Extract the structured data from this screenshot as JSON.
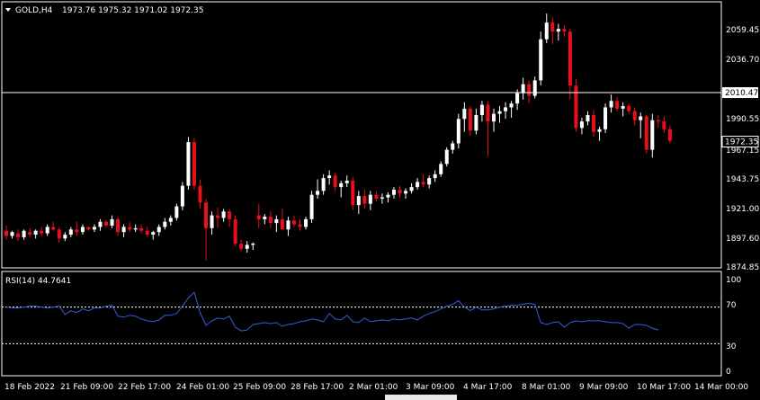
{
  "header": {
    "symbol": "GOLD,H4",
    "ohlc": "1973.76 1975.32 1971.02 1972.35"
  },
  "rsi_header": "RSI(14) 44.7641",
  "colors": {
    "background": "#000000",
    "bull": "#ffffff",
    "bear": "#e8101a",
    "rsi": "#2f5fd8",
    "grid": "#ffffff",
    "hline": "#ffffff"
  },
  "chart_data": [
    {
      "type": "candlestick",
      "symbol": "GOLD",
      "timeframe": "H4",
      "ylim": [
        1870,
        2080
      ],
      "yticks": [
        "2059.45",
        "2036.70",
        "1990.55",
        "1967.15",
        "1943.75",
        "1921.00",
        "1897.60",
        "1874.85"
      ],
      "horizontal_line": {
        "value": 2010.47,
        "label": "2010.47"
      },
      "current_price": {
        "value": 1972.35,
        "label": "1972.35"
      },
      "x_labels": [
        "18 Feb 2022",
        "21 Feb 09:00",
        "22 Feb 17:00",
        "24 Feb 01:00",
        "25 Feb 09:00",
        "28 Feb 17:00",
        "2 Mar 01:00",
        "3 Mar 09:00",
        "4 Mar 17:00",
        "8 Mar 01:00",
        "9 Mar 09:00",
        "10 Mar 17:00",
        "14 Mar 00:00"
      ],
      "candles": [
        [
          1903,
          1907,
          1896,
          1899
        ],
        [
          1899,
          1903,
          1897,
          1902
        ],
        [
          1901,
          1904,
          1895,
          1898
        ],
        [
          1898,
          1904,
          1896,
          1903
        ],
        [
          1902,
          1905,
          1898,
          1900
        ],
        [
          1900,
          1904,
          1897,
          1903
        ],
        [
          1903,
          1906,
          1899,
          1901
        ],
        [
          1901,
          1908,
          1899,
          1906
        ],
        [
          1906,
          1910,
          1903,
          1904
        ],
        [
          1904,
          1906,
          1894,
          1897
        ],
        [
          1897,
          1902,
          1895,
          1900
        ],
        [
          1900,
          1906,
          1898,
          1904
        ],
        [
          1904,
          1910,
          1899,
          1902
        ],
        [
          1902,
          1908,
          1900,
          1906
        ],
        [
          1906,
          1906,
          1903,
          1904
        ],
        [
          1904,
          1908,
          1902,
          1906
        ],
        [
          1906,
          1912,
          1903,
          1910
        ],
        [
          1910,
          1911,
          1905,
          1907
        ],
        [
          1907,
          1915,
          1905,
          1912
        ],
        [
          1912,
          1914,
          1899,
          1902
        ],
        [
          1902,
          1908,
          1898,
          1906
        ],
        [
          1906,
          1910,
          1902,
          1904
        ],
        [
          1904,
          1908,
          1902,
          1905
        ],
        [
          1905,
          1908,
          1901,
          1903
        ],
        [
          1903,
          1906,
          1898,
          1900
        ],
        [
          1900,
          1903,
          1896,
          1902
        ],
        [
          1902,
          1908,
          1899,
          1906
        ],
        [
          1906,
          1913,
          1904,
          1910
        ],
        [
          1910,
          1915,
          1907,
          1913
        ],
        [
          1913,
          1924,
          1911,
          1922
        ],
        [
          1922,
          1941,
          1919,
          1938
        ],
        [
          1938,
          1976,
          1935,
          1972
        ],
        [
          1972,
          1975,
          1935,
          1938
        ],
        [
          1938,
          1943,
          1920,
          1925
        ],
        [
          1925,
          1928,
          1880,
          1905
        ],
        [
          1905,
          1918,
          1900,
          1915
        ],
        [
          1915,
          1921,
          1905,
          1913
        ],
        [
          1913,
          1920,
          1910,
          1918
        ],
        [
          1918,
          1920,
          1906,
          1912
        ],
        [
          1912,
          1915,
          1891,
          1893
        ],
        [
          1893,
          1896,
          1887,
          1889
        ],
        [
          1889,
          1895,
          1886,
          1892
        ],
        [
          1892,
          1894,
          1888,
          1893
        ],
        [
          1915,
          1924,
          1905,
          1912
        ],
        [
          1912,
          1916,
          1908,
          1914
        ],
        [
          1914,
          1918,
          1905,
          1909
        ],
        [
          1909,
          1915,
          1902,
          1912
        ],
        [
          1912,
          1920,
          1907,
          1904
        ],
        [
          1904,
          1914,
          1899,
          1911
        ],
        [
          1911,
          1915,
          1906,
          1908
        ],
        [
          1908,
          1912,
          1903,
          1906
        ],
        [
          1906,
          1914,
          1904,
          1912
        ],
        [
          1912,
          1934,
          1909,
          1931
        ],
        [
          1931,
          1943,
          1928,
          1934
        ],
        [
          1934,
          1947,
          1931,
          1944
        ],
        [
          1944,
          1950,
          1939,
          1946
        ],
        [
          1946,
          1948,
          1934,
          1937
        ],
        [
          1937,
          1942,
          1929,
          1940
        ],
        [
          1940,
          1946,
          1937,
          1942
        ],
        [
          1942,
          1945,
          1919,
          1923
        ],
        [
          1923,
          1934,
          1916,
          1930
        ],
        [
          1930,
          1935,
          1920,
          1924
        ],
        [
          1924,
          1934,
          1919,
          1931
        ],
        [
          1931,
          1934,
          1926,
          1928
        ],
        [
          1928,
          1932,
          1924,
          1929
        ],
        [
          1929,
          1933,
          1925,
          1931
        ],
        [
          1931,
          1937,
          1928,
          1935
        ],
        [
          1935,
          1938,
          1929,
          1932
        ],
        [
          1932,
          1936,
          1928,
          1934
        ],
        [
          1934,
          1940,
          1932,
          1937
        ],
        [
          1937,
          1944,
          1935,
          1941
        ],
        [
          1941,
          1947,
          1937,
          1939
        ],
        [
          1939,
          1946,
          1936,
          1944
        ],
        [
          1944,
          1950,
          1941,
          1947
        ],
        [
          1947,
          1957,
          1945,
          1955
        ],
        [
          1955,
          1968,
          1953,
          1966
        ],
        [
          1966,
          1973,
          1963,
          1971
        ],
        [
          1971,
          1994,
          1967,
          1990
        ],
        [
          1990,
          2003,
          1980,
          1998
        ],
        [
          1998,
          2000,
          1977,
          1981
        ],
        [
          1981,
          1998,
          1978,
          1993
        ],
        [
          1993,
          2004,
          1988,
          2001
        ],
        [
          2001,
          2004,
          1961,
          1988
        ],
        [
          1988,
          1998,
          1980,
          1994
        ],
        [
          1994,
          2000,
          1987,
          1996
        ],
        [
          1996,
          2003,
          1990,
          1999
        ],
        [
          1999,
          2004,
          1991,
          2002
        ],
        [
          2002,
          2013,
          1997,
          2010
        ],
        [
          2010,
          2022,
          2005,
          2017
        ],
        [
          2017,
          2020,
          2002,
          2008
        ],
        [
          2008,
          2023,
          2006,
          2020
        ],
        [
          2020,
          2058,
          2016,
          2052
        ],
        [
          2052,
          2072,
          2049,
          2065
        ],
        [
          2065,
          2069,
          2048,
          2058
        ],
        [
          2058,
          2064,
          2051,
          2060
        ],
        [
          2060,
          2063,
          2054,
          2058
        ],
        [
          2058,
          2060,
          2005,
          2016
        ],
        [
          2016,
          2021,
          1980,
          1983
        ],
        [
          1983,
          1991,
          1978,
          1988
        ],
        [
          1988,
          1996,
          1985,
          1993
        ],
        [
          1993,
          1997,
          1976,
          1980
        ],
        [
          1980,
          1984,
          1973,
          1982
        ],
        [
          1982,
          2002,
          1979,
          1999
        ],
        [
          1999,
          2009,
          1995,
          2004
        ],
        [
          2004,
          2007,
          1996,
          1998
        ],
        [
          1998,
          2003,
          1992,
          2000
        ],
        [
          2000,
          2002,
          1994,
          1996
        ],
        [
          1996,
          1999,
          1985,
          1989
        ],
        [
          1989,
          1995,
          1975,
          1992
        ],
        [
          1992,
          1993,
          1963,
          1966
        ],
        [
          1966,
          1994,
          1960,
          1989
        ],
        [
          1989,
          1993,
          1983,
          1988
        ],
        [
          1988,
          1992,
          1979,
          1982
        ],
        [
          1982,
          1985,
          1971,
          1973
        ]
      ]
    },
    {
      "type": "line",
      "indicator": "RSI",
      "period": 14,
      "value": 44.7641,
      "ylim": [
        0,
        100
      ],
      "yticks": [
        "100",
        "70",
        "30",
        "0"
      ],
      "levels": [
        70,
        30
      ],
      "values": [
        70,
        69,
        69,
        70,
        71,
        71,
        70,
        69,
        70,
        71,
        62,
        66,
        64,
        68,
        66,
        69,
        69,
        71,
        72,
        60,
        59,
        61,
        60,
        57,
        55,
        54,
        56,
        61,
        61,
        63,
        71,
        80,
        86,
        64,
        50,
        55,
        58,
        57,
        60,
        48,
        44,
        45,
        51,
        52,
        53,
        52,
        53,
        49,
        51,
        52,
        54,
        55,
        57,
        56,
        54,
        63,
        57,
        56,
        61,
        54,
        53,
        58,
        54,
        55,
        56,
        55,
        57,
        56,
        57,
        58,
        56,
        60,
        63,
        65,
        68,
        71,
        73,
        77,
        70,
        66,
        70,
        67,
        67,
        68,
        70,
        71,
        72,
        72,
        73,
        74,
        73,
        53,
        51,
        53,
        54,
        48,
        53,
        55,
        54,
        55,
        55,
        55,
        54,
        53,
        53,
        52,
        47,
        51,
        51,
        50,
        47,
        45
      ]
    }
  ]
}
